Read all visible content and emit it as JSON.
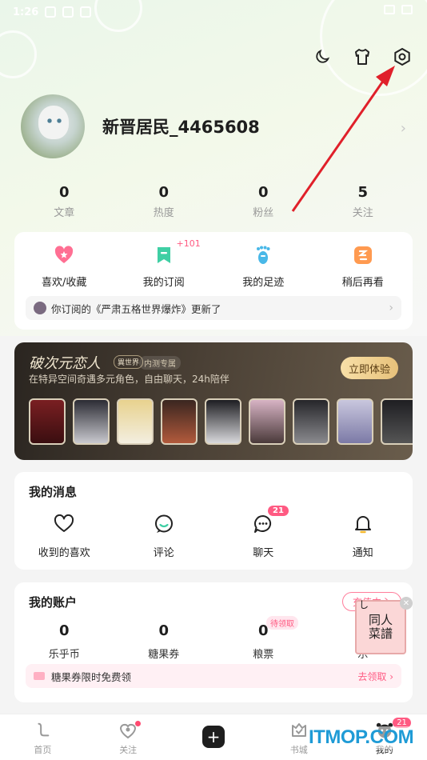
{
  "status": {
    "time": "1:26"
  },
  "profile": {
    "username": "新晋居民_4465608"
  },
  "stats": [
    {
      "value": "0",
      "label": "文章"
    },
    {
      "value": "0",
      "label": "热度"
    },
    {
      "value": "0",
      "label": "粉丝"
    },
    {
      "value": "5",
      "label": "关注"
    }
  ],
  "quick": {
    "items": [
      {
        "label": "喜欢/收藏",
        "icon": "heart-star-icon",
        "color": "#ff6f93"
      },
      {
        "label": "我的订阅",
        "icon": "bookmark-icon",
        "color": "#3fcfa4",
        "badge": "+101"
      },
      {
        "label": "我的足迹",
        "icon": "footprint-icon",
        "color": "#49b8e8"
      },
      {
        "label": "稍后再看",
        "icon": "later-icon",
        "color": "#ff9a50"
      }
    ],
    "notice": "你订阅的《严肃五格世界爆炸》更新了"
  },
  "promo": {
    "title": "破次元恋人",
    "tag1": "異世界",
    "tag2": "内测专属",
    "subtitle": "在特异空间奇遇多元角色，自由聊天，24h陪伴",
    "cta": "立即体验"
  },
  "messages": {
    "title": "我的消息",
    "items": [
      {
        "label": "收到的喜欢",
        "icon": "heart-icon"
      },
      {
        "label": "评论",
        "icon": "comment-icon"
      },
      {
        "label": "聊天",
        "icon": "chat-icon",
        "badge": "21"
      },
      {
        "label": "通知",
        "icon": "bell-icon"
      }
    ]
  },
  "account": {
    "title": "我的账户",
    "recharge": "充值中心",
    "items": [
      {
        "value": "0",
        "label": "乐乎币"
      },
      {
        "value": "0",
        "label": "糖果券"
      },
      {
        "value": "0",
        "label": "粮票",
        "tag": "待领取"
      },
      {
        "value": "",
        "label": "乐"
      }
    ],
    "coupon_text": "糖果券限时免费领",
    "coupon_cta": "去领取"
  },
  "float_ad": {
    "line1": "同人",
    "line2": "菜譜",
    "mark": "し"
  },
  "tabs": [
    {
      "label": "首页",
      "icon": "home-icon"
    },
    {
      "label": "关注",
      "icon": "follow-icon"
    },
    {
      "label": "",
      "icon": "plus-icon"
    },
    {
      "label": "书城",
      "icon": "bookstore-icon"
    },
    {
      "label": "我的",
      "icon": "me-icon",
      "badge": "21"
    }
  ],
  "watermark": "ITMOP.COM"
}
